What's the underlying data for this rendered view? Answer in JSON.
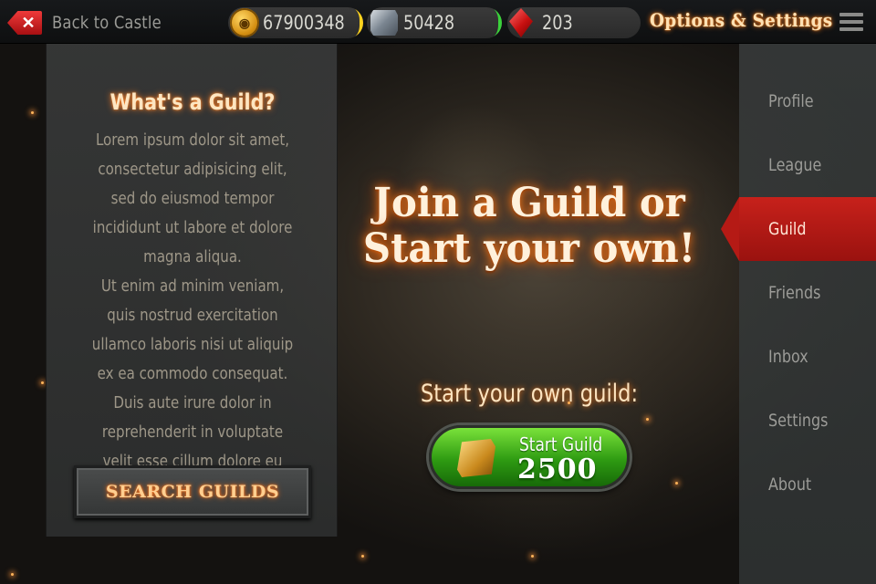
{
  "topbar": {
    "back_label": "Back to Castle",
    "gold": "67900348",
    "iron": "50428",
    "gems": "203",
    "options_title": "Options & Settings",
    "accent_gold": "#ffd21e",
    "accent_green": "#3bd23b"
  },
  "info": {
    "title": "What's a Guild?",
    "paragraph1": "Lorem ipsum dolor sit amet, consectetur adipisicing elit, sed do eiusmod tempor incididunt ut labore et dolore magna aliqua.",
    "paragraph2": "Ut enim ad minim veniam, quis nostrud exercitation ullamco laboris nisi ut aliquip ex ea commodo consequat. Duis aute irure dolor in reprehenderit in voluptate velit esse cillum dolore eu fugiat nulla!",
    "search_button": "SEARCH GUILDS"
  },
  "main": {
    "headline_line1": "Join a Guild or",
    "headline_line2": "Start your own!",
    "start_label": "Start your own guild:",
    "start_button_label": "Start Guild",
    "start_button_price": "2500"
  },
  "nav": {
    "items": [
      {
        "label": "Profile"
      },
      {
        "label": "League"
      },
      {
        "label": "Guild"
      },
      {
        "label": "Friends"
      },
      {
        "label": "Inbox"
      },
      {
        "label": "Settings"
      },
      {
        "label": "About"
      }
    ],
    "active": "Guild",
    "active_color": "#b51a15"
  },
  "icons": {
    "back": "close-x-icon",
    "gold": "gold-coin-icon",
    "iron": "iron-ingot-icon",
    "gems": "red-gem-icon",
    "menu": "hamburger-menu-icon",
    "scroll": "guild-scroll-icon"
  }
}
